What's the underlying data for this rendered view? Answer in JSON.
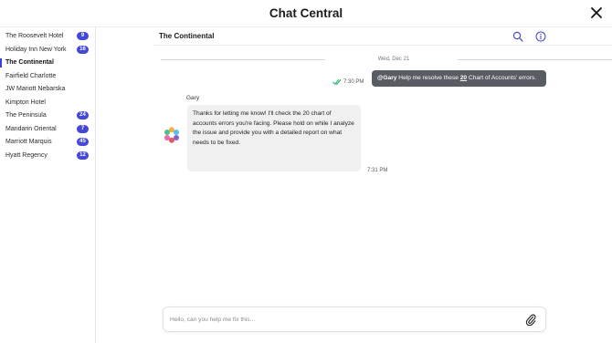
{
  "app": {
    "title": "Chat Central"
  },
  "sidebar": {
    "items": [
      {
        "label": "The Roosevelt Hotel",
        "badge": "9",
        "active": false
      },
      {
        "label": "Holiday Inn New York",
        "badge": "16",
        "active": false
      },
      {
        "label": "The Continental",
        "badge": "",
        "active": true
      },
      {
        "label": "Fairfield Charlotte",
        "badge": "",
        "active": false
      },
      {
        "label": "JW Mariott Nebarska",
        "badge": "",
        "active": false
      },
      {
        "label": "Kimpton Hotel",
        "badge": "",
        "active": false
      },
      {
        "label": "The Peninsula",
        "badge": "24",
        "active": false
      },
      {
        "label": "Mandarin Oriental",
        "badge": "7",
        "active": false
      },
      {
        "label": "Marriott Marquis",
        "badge": "45",
        "active": false
      },
      {
        "label": "Hyatt Regency",
        "badge": "12",
        "active": false
      }
    ]
  },
  "chat": {
    "title": "The Continental",
    "date_divider": "Wed, Dec 21",
    "outgoing": {
      "mention": "@Gary",
      "text_before": " Help me resolve these ",
      "number": "20",
      "text_after": " Chart of Accounts' errors.",
      "time": "7:30 PM"
    },
    "incoming": {
      "sender": "Gary",
      "text": "Thanks for letting me know! I'll check the 20 chart of accounts errors you're facing. Please hold on while I analyze the issue and provide you with a detailed report on what needs to be fixed.",
      "time": "7:31 PM"
    }
  },
  "composer": {
    "placeholder": "Hello, can you help me fix this...",
    "value": ""
  },
  "icons": {
    "close": "close-icon",
    "search": "search-icon",
    "info": "info-icon",
    "attach": "paperclip-icon",
    "read_receipt": "double-check-icon",
    "avatar": "flower-avatar"
  },
  "colors": {
    "accent": "#4547d9",
    "outgoing_bubble": "#5a5c63",
    "incoming_bubble": "#f0f0f1",
    "read_check": "#2bb673"
  }
}
